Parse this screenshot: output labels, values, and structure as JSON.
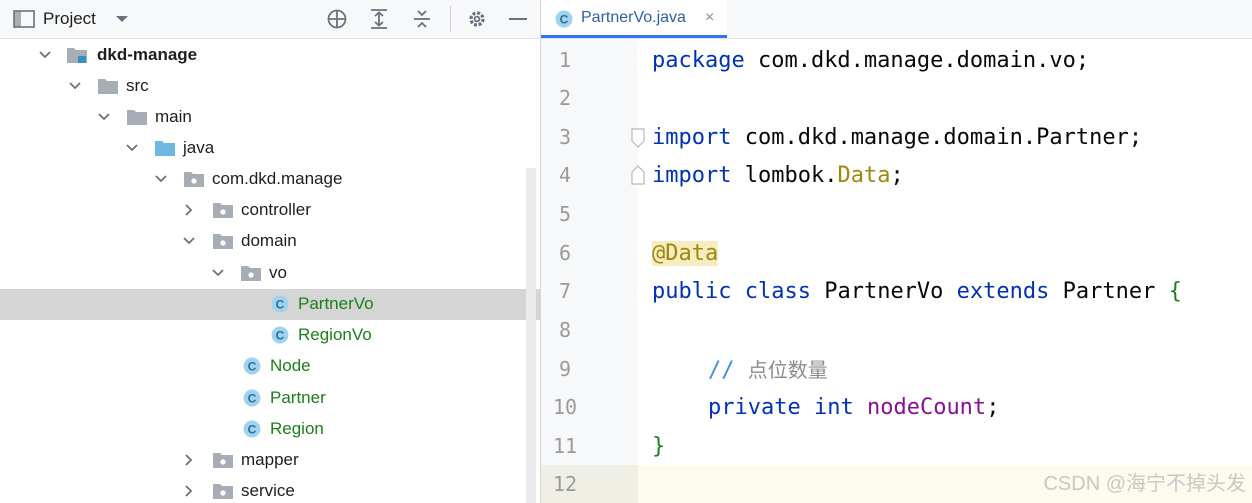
{
  "project_panel": {
    "title": "Project",
    "tree": [
      {
        "label": "dkd-manage",
        "icon": "module-folder-icon",
        "state": "expanded"
      },
      {
        "label": "src",
        "icon": "folder-icon",
        "state": "expanded"
      },
      {
        "label": "main",
        "icon": "folder-icon",
        "state": "expanded"
      },
      {
        "label": "java",
        "icon": "source-folder-icon",
        "state": "expanded"
      },
      {
        "label": "com.dkd.manage",
        "icon": "package-icon",
        "state": "expanded"
      },
      {
        "label": "controller",
        "icon": "package-icon",
        "state": "collapsed"
      },
      {
        "label": "domain",
        "icon": "package-icon",
        "state": "expanded"
      },
      {
        "label": "vo",
        "icon": "package-icon",
        "state": "expanded"
      },
      {
        "label": "PartnerVo",
        "icon": "class-icon",
        "state": "leaf",
        "selected": true
      },
      {
        "label": "RegionVo",
        "icon": "class-icon",
        "state": "leaf"
      },
      {
        "label": "Node",
        "icon": "class-icon",
        "state": "leaf"
      },
      {
        "label": "Partner",
        "icon": "class-icon",
        "state": "leaf"
      },
      {
        "label": "Region",
        "icon": "class-icon",
        "state": "leaf"
      },
      {
        "label": "mapper",
        "icon": "package-icon",
        "state": "collapsed"
      },
      {
        "label": "service",
        "icon": "package-icon",
        "state": "collapsed"
      }
    ]
  },
  "editor": {
    "tab": {
      "label": "PartnerVo.java",
      "close": "×"
    },
    "line_numbers": [
      "1",
      "2",
      "3",
      "4",
      "5",
      "6",
      "7",
      "8",
      "9",
      "10",
      "11",
      "12"
    ],
    "code": {
      "l1_kw": "package",
      "l1_rest": " com.dkd.manage.domain.vo;",
      "l3_kw": "import",
      "l3_rest": " com.dkd.manage.domain.Partner;",
      "l4_kw": "import",
      "l4_mid": " lombok.",
      "l4_cls": "Data",
      "l4_end": ";",
      "l6_ann": "@Data",
      "l7_kw1": "public",
      "l7_kw2": "class",
      "l7_name": " PartnerVo ",
      "l7_kw3": "extends",
      "l7_parent": " Partner ",
      "l7_brace": "{",
      "l9_mark": "// ",
      "l9_comment": "点位数量",
      "l10_kw1": "private",
      "l10_kw2": "int",
      "l10_field": "nodeCount",
      "l10_end": ";",
      "l11_brace": "}"
    }
  },
  "watermark": "CSDN @海宁不掉头发",
  "colors": {
    "keyword": "#0033b3",
    "annotation": "#9e880d",
    "field": "#871094",
    "class_green": "#1a7f1a",
    "selection": "#d5d5d5"
  }
}
